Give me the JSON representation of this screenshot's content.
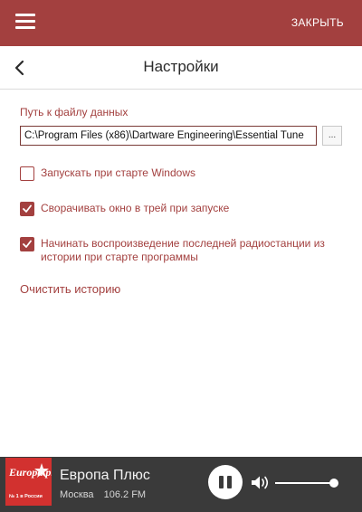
{
  "topbar": {
    "close_label": "ЗАКРЫТЬ",
    "accent_color": "#a3403f"
  },
  "header": {
    "title": "Настройки"
  },
  "settings": {
    "path_label": "Путь к файлу данных",
    "path_value": "C:\\Program Files (x86)\\Dartware Engineering\\Essential Tune",
    "browse_label": "...",
    "options": [
      {
        "label": "Запускать при старте Windows",
        "checked": false
      },
      {
        "label": "Сворачивать окно в трей при запуске",
        "checked": true
      },
      {
        "label": "Начинать воспроизведение последней радиостанции из истории при старте программы",
        "checked": true
      }
    ],
    "clear_history_label": "Очистить историю"
  },
  "player": {
    "station_name": "Европа Плюс",
    "city": "Москва",
    "frequency": "106.2 FM",
    "logo_text_main": "Europa plus",
    "logo_text_sub": "№ 1 в России",
    "state": "playing",
    "volume": 0.88,
    "background_color": "#3a3a3a"
  }
}
